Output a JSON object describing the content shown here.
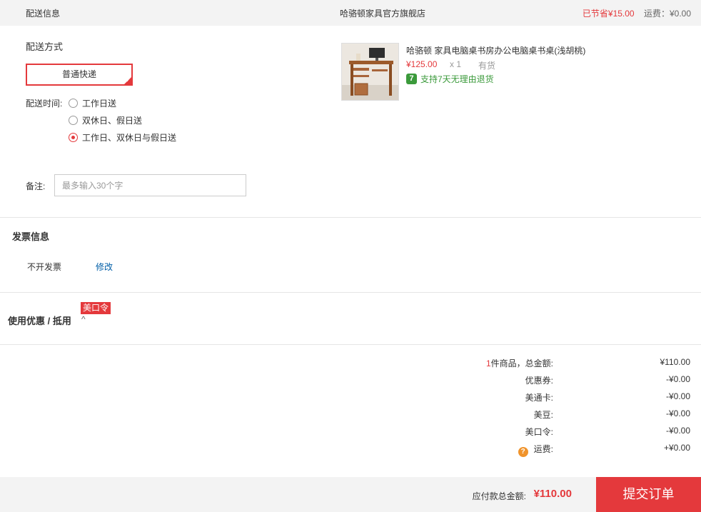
{
  "header": {
    "title": "配送信息",
    "store_name": "哈骆顿家具官方旗舰店",
    "saved": "已节省¥15.00",
    "shipping": "运费：¥0.00"
  },
  "delivery": {
    "method_label": "配送方式",
    "method_button": "普通快递",
    "time_label": "配送时间:",
    "options": [
      {
        "label": "工作日送",
        "selected": false
      },
      {
        "label": "双休日、假日送",
        "selected": false
      },
      {
        "label": "工作日、双休日与假日送",
        "selected": true
      }
    ],
    "note_label": "备注:",
    "note_placeholder": "最多输入30个字",
    "note_value": ""
  },
  "product": {
    "title": "哈骆顿 家具电脑桌书房办公电脑桌书桌(浅胡桃)",
    "price": "¥125.00",
    "qty": "x 1",
    "stock": "有货",
    "return_icon": "7",
    "return_text": "支持7天无理由退货"
  },
  "invoice": {
    "title": "发票信息",
    "value": "不开发票",
    "edit_label": "修改"
  },
  "promo": {
    "title": "使用优惠 / 抵用",
    "badge": "美口令",
    "chevron": "^"
  },
  "summary": {
    "count": "1",
    "count_suffix": "件商品，总金额:",
    "total": "¥110.00",
    "rows": [
      {
        "label": "优惠券:",
        "value": "-¥0.00"
      },
      {
        "label": "美通卡:",
        "value": "-¥0.00"
      },
      {
        "label": "美豆:",
        "value": "-¥0.00"
      },
      {
        "label": "美口令:",
        "value": "-¥0.00"
      }
    ],
    "shipping_label": "运费:",
    "shipping_value": "+¥0.00"
  },
  "footer": {
    "pay_label": "应付款总金额:",
    "pay_amount": "¥110.00",
    "submit_label": "提交订单"
  },
  "colors": {
    "accent": "#e4393c",
    "green": "#3b9a3b",
    "link": "#005ea7",
    "bar_bg": "#f3f3f3"
  }
}
